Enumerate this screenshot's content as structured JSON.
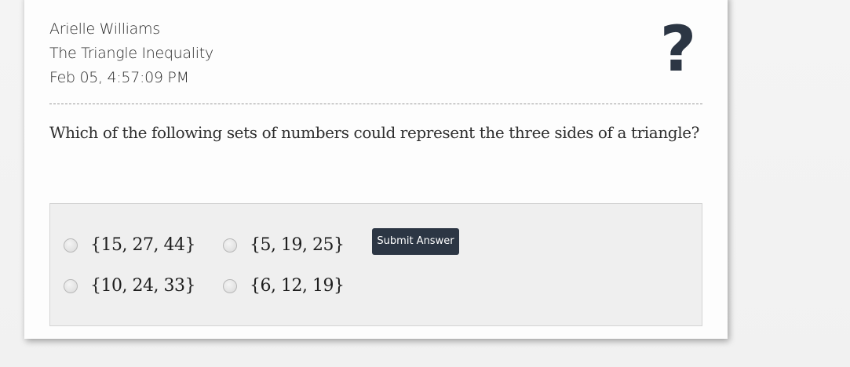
{
  "header": {
    "student_name": "Arielle Williams",
    "topic": "The Triangle Inequality",
    "timestamp": "Feb 05, 4:57:09 PM",
    "help_icon": "question-mark-icon",
    "help_symbol": "?"
  },
  "question": {
    "text": "Which of the following sets of numbers could represent the three sides of a triangle?"
  },
  "choices": [
    {
      "label": "{15, 27, 44}",
      "selected": false
    },
    {
      "label": "{5, 19, 25}",
      "selected": false
    },
    {
      "label": "{10, 24, 33}",
      "selected": false
    },
    {
      "label": "{6, 12, 19}",
      "selected": false
    }
  ],
  "actions": {
    "submit_label": "Submit Answer"
  },
  "colors": {
    "accent": "#2c3644",
    "card_bg": "#fdfdfd",
    "answer_bg": "#efefef"
  }
}
